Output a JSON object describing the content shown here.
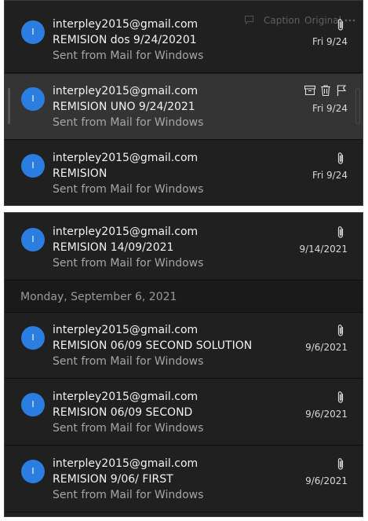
{
  "toolbar": {
    "caption_label": "Caption",
    "original_label": "Original"
  },
  "group_header": {
    "label": "Monday, September 6, 2021"
  },
  "messages": [
    {
      "from": "interpley2015@gmail.com",
      "subject": "REMISION dos 9/24/20201",
      "preview": "Sent from Mail for Windows",
      "date": "Fri 9/24",
      "avatar": "I"
    },
    {
      "from": "interpley2015@gmail.com",
      "subject": "REMISION UNO 9/24/2021",
      "preview": "Sent from Mail for Windows",
      "date": "Fri 9/24",
      "avatar": "I"
    },
    {
      "from": "interpley2015@gmail.com",
      "subject": "REMISION",
      "preview": "Sent from Mail for Windows",
      "date": "Fri 9/24",
      "avatar": "I"
    },
    {
      "from": "interpley2015@gmail.com",
      "subject": "REMISION 14/09/2021",
      "preview": "Sent from Mail for Windows",
      "date": "9/14/2021",
      "avatar": "I"
    },
    {
      "from": "interpley2015@gmail.com",
      "subject": "REMISION 06/09 SECOND SOLUTION",
      "preview": "Sent from Mail for Windows",
      "date": "9/6/2021",
      "avatar": "I"
    },
    {
      "from": "interpley2015@gmail.com",
      "subject": "REMISION 06/09 SECOND",
      "preview": "Sent from Mail for Windows",
      "date": "9/6/2021",
      "avatar": "I"
    },
    {
      "from": "interpley2015@gmail.com",
      "subject": "REMISION 9/06/ FIRST",
      "preview": "Sent from Mail for Windows",
      "date": "9/6/2021",
      "avatar": "I"
    }
  ],
  "icons": {
    "attachment": "paperclip-icon",
    "archive": "archive-icon",
    "delete": "trash-icon",
    "flag": "flag-icon",
    "comment": "comment-icon",
    "more": "more-icon"
  },
  "colors": {
    "avatar": "#2b7de0",
    "background": "#202020",
    "selected": "#343434"
  }
}
